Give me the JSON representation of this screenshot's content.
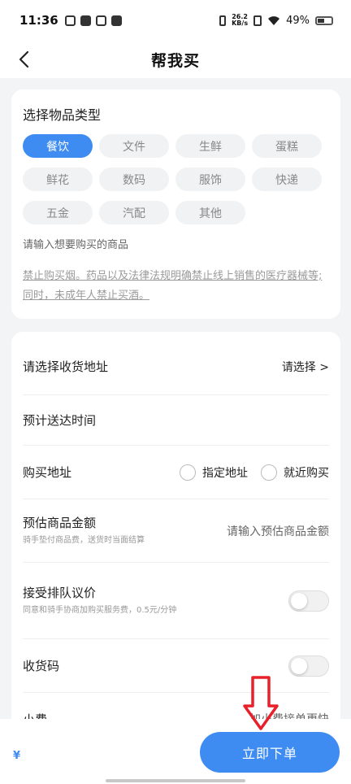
{
  "status": {
    "time": "11:36",
    "speed": "26.2",
    "speed_unit": "KB/s",
    "battery": "49%"
  },
  "nav": {
    "title": "帮我买"
  },
  "category": {
    "title": "选择物品类型",
    "tags": [
      "餐饮",
      "文件",
      "生鲜",
      "蛋糕",
      "鲜花",
      "数码",
      "服饰",
      "快递",
      "五金",
      "汽配",
      "其他"
    ],
    "selected": "餐饮",
    "hint": "请输入想要购买的商品",
    "notice": "禁止购买烟。药品以及法律法规明确禁止线上销售的医疗器械等;同时，未成年人禁止买酒。"
  },
  "form": {
    "address_label": "请选择收货地址",
    "address_value": "请选择 >",
    "time_label": "预计送达时间",
    "purchase_label": "购买地址",
    "option_specified": "指定地址",
    "option_nearby": "就近购买",
    "amount_label": "预估商品金额",
    "amount_sub": "骑手垫付商品费，送货时当面结算",
    "amount_placeholder": "请输入预估商品金额",
    "queue_label": "接受排队议价",
    "queue_sub": "同意和骑手协商加购买服务费，0.5元/分钟",
    "code_label": "收货码",
    "tip_label": "小费",
    "tip_value": "加小费接单更快"
  },
  "bottom": {
    "price": "¥",
    "order_button": "立即下单"
  },
  "colors": {
    "accent": "#3e8cf2",
    "arrow": "#e8202a"
  }
}
